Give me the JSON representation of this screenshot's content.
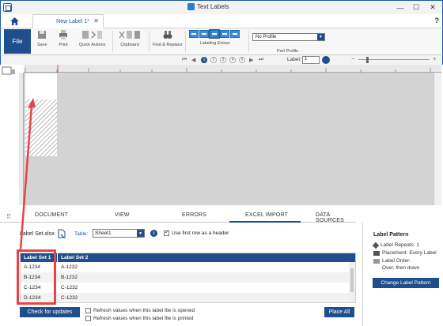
{
  "window": {
    "title": "Text Labels",
    "icons": {
      "app": "app-window-icon",
      "minimize": "minimize-icon",
      "maximize": "maximize-icon",
      "close": "close-icon"
    }
  },
  "tabs": {
    "home_icon": "home-icon",
    "document_tab": "New Label 1*",
    "close_glyph": "✕",
    "help_glyph": "?"
  },
  "ribbon": {
    "file": "File",
    "save": "Save",
    "print": "Print",
    "quick_actions": "Quick Actions",
    "clipboard": "Clipboard",
    "find_replace": "Find & Replace",
    "labeling_extras": "Labeling Extras",
    "profile_select": "No Profile",
    "part_profile": "Part Profile"
  },
  "navigation": {
    "pages": [
      "1",
      "2",
      "3",
      "4",
      "5"
    ],
    "active_page": "1",
    "label_caption": "Label:",
    "label_value": "1"
  },
  "bottom_tabs": [
    "DOCUMENT",
    "VIEW",
    "ERRORS",
    "EXCEL IMPORT",
    "DATA SOURCES"
  ],
  "active_bottom_tab": "EXCEL IMPORT",
  "excel_import": {
    "filename": "Label Set.xlsx",
    "table_caption": "Table:",
    "sheet": "Sheet1",
    "use_first_row_header": "Use first row as a header",
    "use_first_row_checked": true,
    "columns": [
      "Label Set 1",
      "Label Set 2"
    ],
    "rows": [
      [
        "A-1234",
        "A-1232"
      ],
      [
        "B-1234",
        "B-1232"
      ],
      [
        "C-1234",
        "C-1232"
      ],
      [
        "D-1234",
        "C-1232"
      ]
    ],
    "check_updates": "Check for updates",
    "refresh_opened": "Refresh values when this label file is opened",
    "refresh_printed": "Refresh values when this label file is printed",
    "place_all": "Place All"
  },
  "label_pattern": {
    "title": "Label Pattern",
    "repeats": "Label Repeats: 1",
    "placement": "Placement: Every Label",
    "order_caption": "Label Order:",
    "order_value": "Over, then down",
    "change_button": "Change Label Pattern"
  },
  "colors": {
    "accent": "#1f4e8c",
    "highlight": "#2f7bd3",
    "annotation": "#e8434a"
  }
}
